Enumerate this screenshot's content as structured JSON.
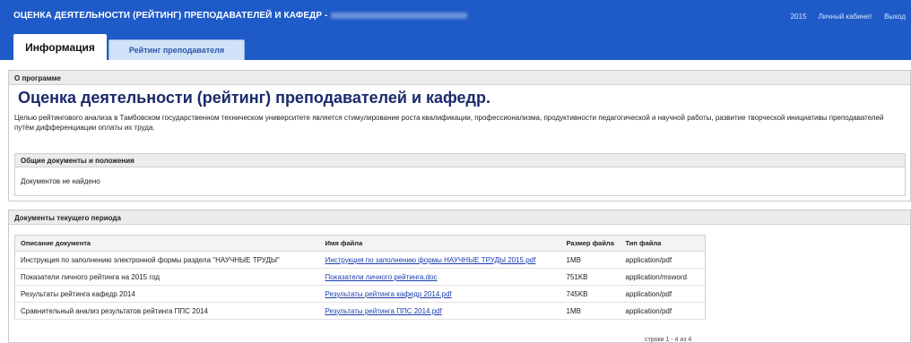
{
  "header": {
    "title": "ОЦЕНКА ДЕЯТЕЛЬНОСТИ (РЕЙТИНГ) ПРЕПОДАВАТЕЛЕЙ И КАФЕДР -",
    "year": "2015",
    "cabinet": "Личный кабинет",
    "logout": "Выход"
  },
  "tabs": [
    {
      "label": "Информация",
      "active": true
    },
    {
      "label": "Рейтинг преподавателя",
      "active": false
    }
  ],
  "about": {
    "header": "О программе",
    "title": "Оценка деятельности (рейтинг) преподавателей и кафедр.",
    "text": "Целью рейтингового анализа в Тамбовском государственном техническом университете является стимулирование роста квалификации, профессионализма, продуктивности педагогической и научной работы, развитие творческой инициативы преподавателей путём дифференциации оплаты их труда.",
    "general_docs": {
      "header": "Общие документы и положения",
      "empty": "Документов не найдено"
    }
  },
  "current_docs": {
    "header": "Документы текущего периода",
    "columns": [
      "Описание документа",
      "Имя файла",
      "Размер файла",
      "Тип файла"
    ],
    "rows": [
      [
        "Инструкция по заполнению электронной формы раздела \"НАУЧНЫЕ ТРУДЫ\"",
        "Инструкция по заполнению формы НАУЧНЫЕ ТРУДЫ 2015.pdf",
        "1MB",
        "application/pdf"
      ],
      [
        "Показатели личного рейтинга на 2015 год",
        "Показатели личного рейтинга.doc",
        "751KB",
        "application/msword"
      ],
      [
        "Результаты рейтинга кафедр 2014",
        "Результаты рейтинга кафедр 2014.pdf",
        "745KB",
        "application/pdf"
      ],
      [
        "Сравнительный анализ результатов рейтинга ППС 2014",
        "Результаты рейтинга ППС 2014.pdf",
        "1MB",
        "application/pdf"
      ]
    ],
    "pager": "строки 1 - 4 из 4"
  },
  "colors": {
    "header_bg": "#1e5ac8",
    "title": "#1b2a6b",
    "link": "#1a3db0"
  }
}
